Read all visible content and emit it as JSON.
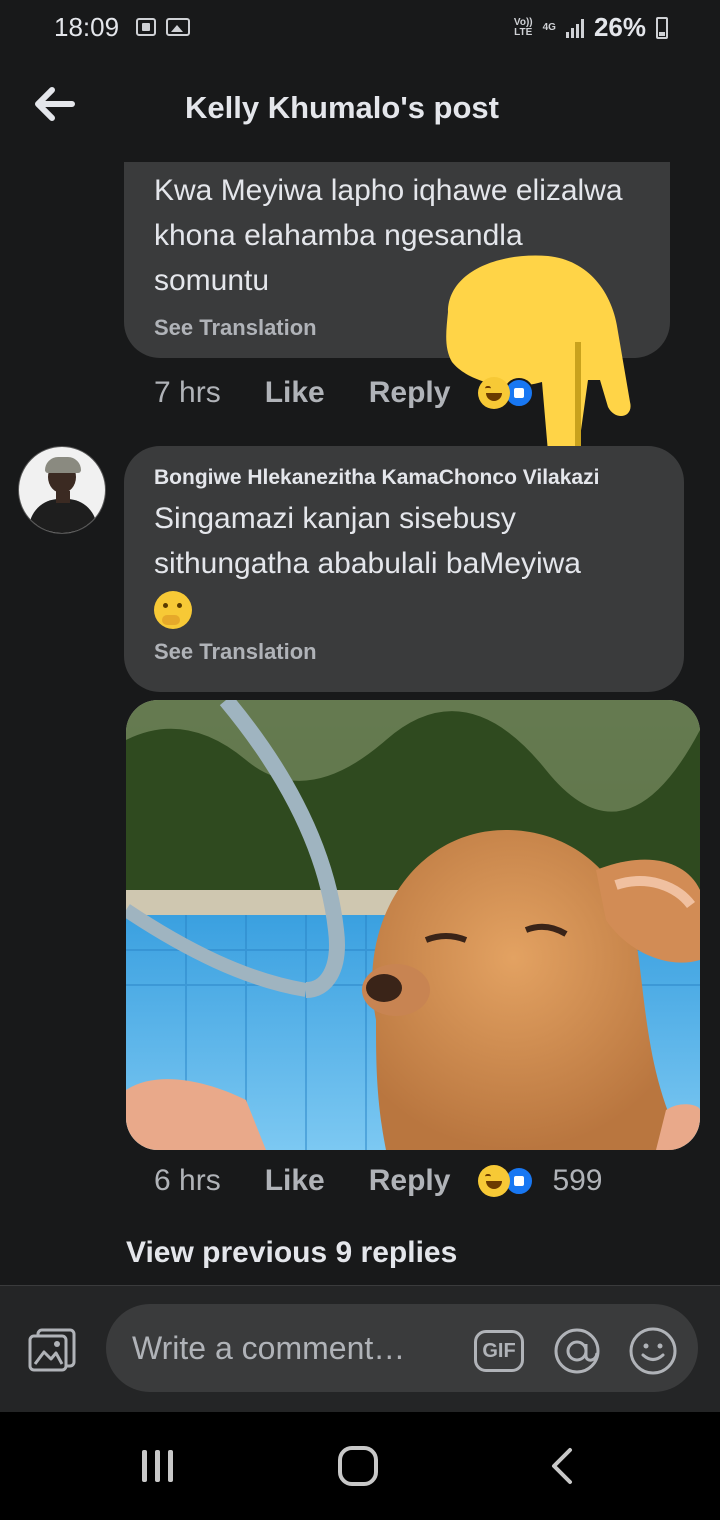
{
  "status_bar": {
    "time": "18:09",
    "net_top": "Vo))",
    "net_bottom": "LTE",
    "data_type": "4G",
    "battery_pct": "26%"
  },
  "header": {
    "title": "Kelly Khumalo's post"
  },
  "comment1": {
    "text": "Kwa Meyiwa lapho iqhawe elizalwa khona elahamba ngesandla somuntu",
    "see_translation": "See Translation",
    "time": "7 hrs",
    "like": "Like",
    "reply": "Reply"
  },
  "comment2": {
    "author": "Bongiwe Hlekanezitha KamaChonco Vilakazi",
    "text": "Singamazi kanjan sisebusy sithungatha ababulali baMeyiwa",
    "see_translation": "See Translation",
    "time": "6 hrs",
    "like": "Like",
    "reply": "Reply",
    "reaction_count": "599"
  },
  "view_previous": "View previous 9 replies",
  "composer": {
    "placeholder": "Write a comment…",
    "gif_label": "GIF"
  },
  "colors": {
    "background": "#18191a",
    "bubble": "#3a3b3c",
    "like_blue": "#1877f2",
    "haha_yellow": "#f7c936"
  }
}
